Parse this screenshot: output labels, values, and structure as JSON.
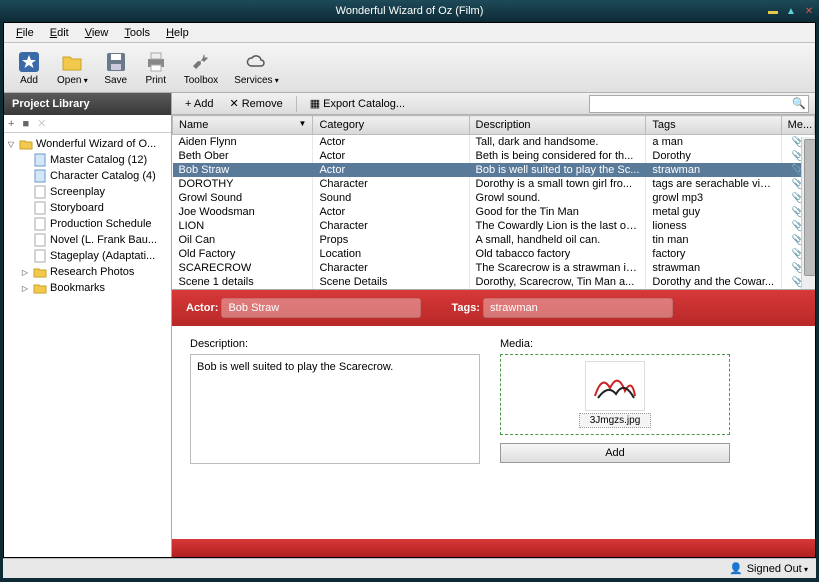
{
  "window": {
    "title": "Wonderful Wizard of Oz (Film)"
  },
  "menu": [
    "File",
    "Edit",
    "View",
    "Tools",
    "Help"
  ],
  "toolbar": [
    {
      "id": "add",
      "label": "Add",
      "icon": "star"
    },
    {
      "id": "open",
      "label": "Open",
      "icon": "folder",
      "drop": true
    },
    {
      "id": "save",
      "label": "Save",
      "icon": "disk"
    },
    {
      "id": "print",
      "label": "Print",
      "icon": "printer"
    },
    {
      "id": "toolbox",
      "label": "Toolbox",
      "icon": "wrench"
    },
    {
      "id": "services",
      "label": "Services",
      "icon": "cloud",
      "drop": true
    }
  ],
  "sidebar": {
    "header": "Project Library",
    "tree": [
      {
        "l": 1,
        "arrow": "▽",
        "icon": "folder-y",
        "text": "Wonderful Wizard of O..."
      },
      {
        "l": 2,
        "arrow": "",
        "icon": "doc-b",
        "text": "Master Catalog (12)"
      },
      {
        "l": 2,
        "arrow": "",
        "icon": "doc-b",
        "text": "Character Catalog (4)"
      },
      {
        "l": 2,
        "arrow": "",
        "icon": "doc",
        "text": "Screenplay"
      },
      {
        "l": 2,
        "arrow": "",
        "icon": "doc",
        "text": "Storyboard"
      },
      {
        "l": 2,
        "arrow": "",
        "icon": "doc",
        "text": "Production Schedule"
      },
      {
        "l": 2,
        "arrow": "",
        "icon": "doc",
        "text": "Novel (L. Frank Bau..."
      },
      {
        "l": 2,
        "arrow": "",
        "icon": "doc",
        "text": "Stageplay (Adaptati..."
      },
      {
        "l": 2,
        "arrow": "▷",
        "icon": "folder-y",
        "text": "Research Photos"
      },
      {
        "l": 2,
        "arrow": "▷",
        "icon": "folder-y",
        "text": "Bookmarks"
      }
    ]
  },
  "tabletools": {
    "add": "Add",
    "remove": "Remove",
    "export": "Export Catalog...",
    "search_placeholder": ""
  },
  "columns": [
    "Name",
    "Category",
    "Description",
    "Tags",
    "Me..."
  ],
  "rows": [
    {
      "name": "Aiden Flynn",
      "cat": "Actor",
      "desc": "Tall, dark and handsome.",
      "tags": "a man"
    },
    {
      "name": "Beth Ober",
      "cat": "Actor",
      "desc": "Beth is being considered for th...",
      "tags": "Dorothy"
    },
    {
      "name": "Bob Straw",
      "cat": "Actor",
      "desc": "Bob is well suited to play the Sc...",
      "tags": "strawman",
      "sel": true
    },
    {
      "name": "DOROTHY",
      "cat": "Character",
      "desc": "Dorothy is a small town girl fro...",
      "tags": "tags are serachable via t..."
    },
    {
      "name": "Growl Sound",
      "cat": "Sound",
      "desc": "Growl sound.",
      "tags": "growl mp3"
    },
    {
      "name": "Joe Woodsman",
      "cat": "Actor",
      "desc": "Good for the Tin Man",
      "tags": "metal guy"
    },
    {
      "name": "LION",
      "cat": "Character",
      "desc": "The Cowardly Lion is the last of ...",
      "tags": "lioness"
    },
    {
      "name": "Oil Can",
      "cat": "Props",
      "desc": "A small, handheld oil can.",
      "tags": "tin man"
    },
    {
      "name": "Old Factory",
      "cat": "Location",
      "desc": "Old tabacco factory",
      "tags": "factory"
    },
    {
      "name": "SCARECROW",
      "cat": "Character",
      "desc": "The Scarecrow is a strawman in ...",
      "tags": "strawman"
    },
    {
      "name": "Scene 1 details",
      "cat": "Scene Details",
      "desc": "Dorothy, Scarecrow, Tin Man a...",
      "tags": "Dorothy and the Cowar..."
    }
  ],
  "detail": {
    "type_label": "Actor:",
    "name": "Bob Straw",
    "tags_label": "Tags:",
    "tags": "strawman",
    "desc_label": "Description:",
    "desc": "Bob is well suited to play the Scarecrow.",
    "media_label": "Media:",
    "media_file": "3Jmgzs.jpg",
    "add_btn": "Add"
  },
  "status": {
    "right": "Signed Out"
  }
}
